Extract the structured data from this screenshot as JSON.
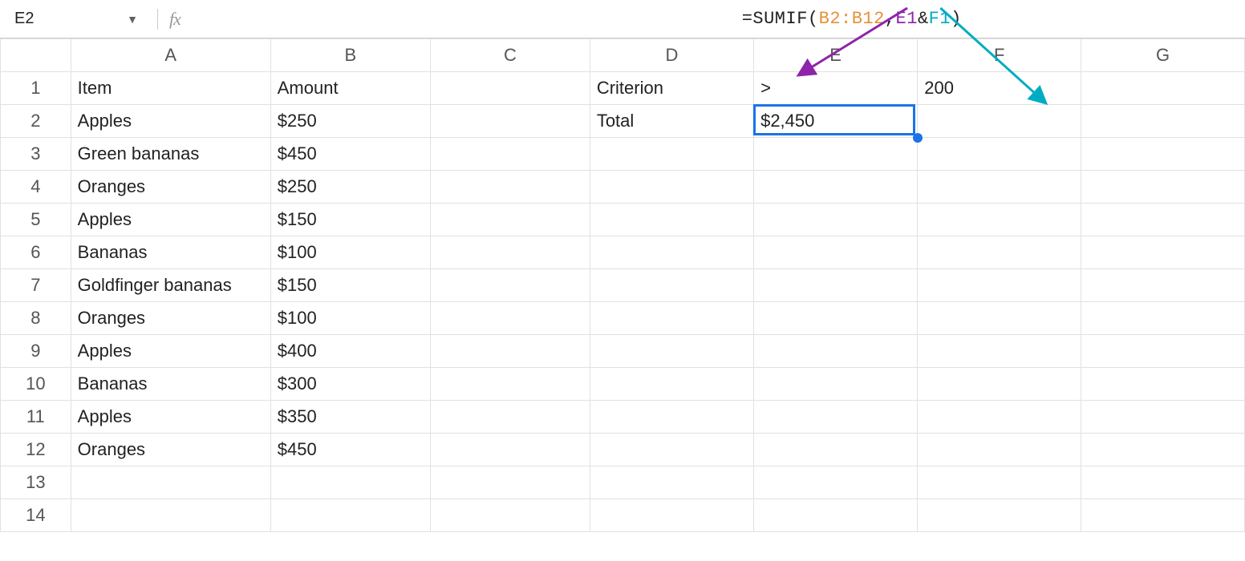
{
  "nameBox": "E2",
  "formula": {
    "prefix": "=SUMIF(",
    "range": "B2:B12",
    "sep1": ",",
    "arg2": "E1",
    "amp": "&",
    "arg3": "F1",
    "close": ")"
  },
  "columns": [
    "A",
    "B",
    "C",
    "D",
    "E",
    "F",
    "G"
  ],
  "rowCount": 14,
  "cells": {
    "A1": "Item",
    "B1": "Amount",
    "D1": "Criterion",
    "E1": ">",
    "F1": "200",
    "D2": "Total",
    "E2": "$2,450",
    "A2": "Apples",
    "B2": "$250",
    "A3": "Green bananas",
    "B3": "$450",
    "A4": "Oranges",
    "B4": "$250",
    "A5": "Apples",
    "B5": "$150",
    "A6": "Bananas",
    "B6": "$100",
    "A7": "Goldfinger bananas",
    "B7": "$150",
    "A8": "Oranges",
    "B8": "$100",
    "A9": "Apples",
    "B9": "$400",
    "A10": "Bananas",
    "B10": "$300",
    "A11": "Apples",
    "B11": "$350",
    "A12": "Oranges",
    "B12": "$450"
  },
  "selectedCell": "E2",
  "chart_data": {
    "type": "table",
    "title": "",
    "columns": [
      "Item",
      "Amount"
    ],
    "rows": [
      [
        "Apples",
        250
      ],
      [
        "Green bananas",
        450
      ],
      [
        "Oranges",
        250
      ],
      [
        "Apples",
        150
      ],
      [
        "Bananas",
        100
      ],
      [
        "Goldfinger bananas",
        150
      ],
      [
        "Oranges",
        100
      ],
      [
        "Apples",
        400
      ],
      [
        "Bananas",
        300
      ],
      [
        "Apples",
        350
      ],
      [
        "Oranges",
        450
      ]
    ],
    "criterion": {
      "operator": ">",
      "value": 200
    },
    "total": 2450
  }
}
